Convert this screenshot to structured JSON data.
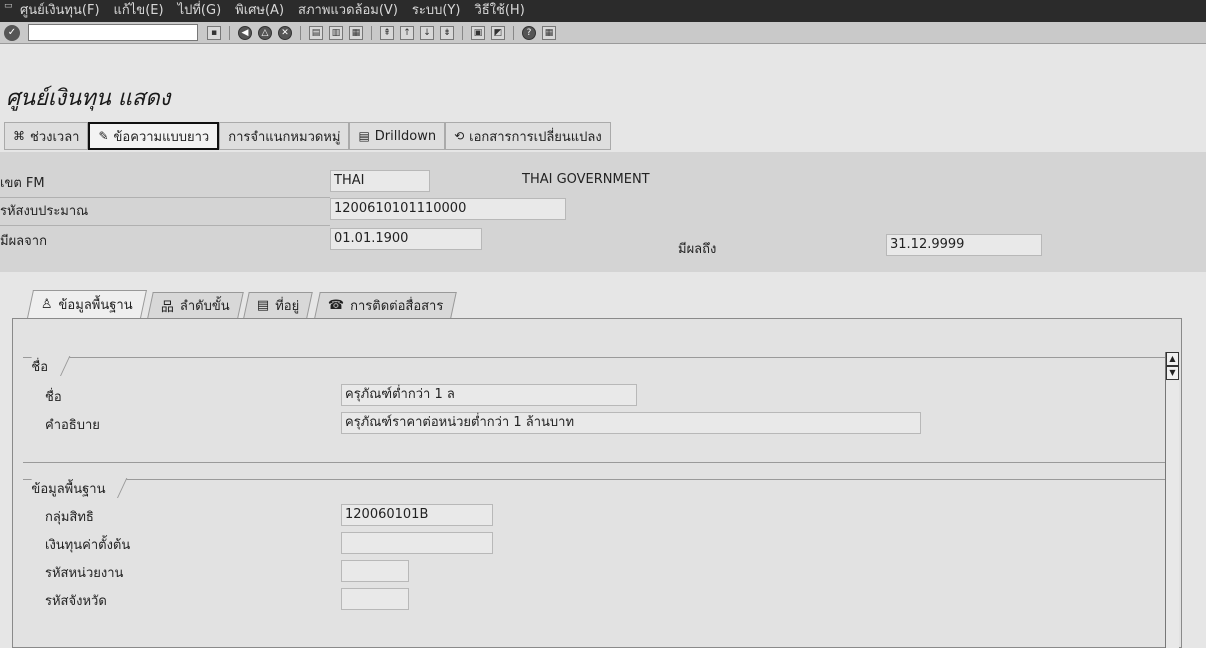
{
  "menu": {
    "items": [
      "ศูนย์เงินทุน(F)",
      "แก้ไข(E)",
      "ไปที่(G)",
      "พิเศษ(A)",
      "สภาพแวดล้อม(V)",
      "ระบบ(Y)",
      "วิธีใช้(H)"
    ]
  },
  "page": {
    "title": "ศูนย์เงินทุน แสดง"
  },
  "app_toolbar": {
    "period": "ช่วงเวลา",
    "long_text": "ข้อความแบบยาว",
    "classification": "การจำแนกหมวดหมู่",
    "drilldown": "Drilldown",
    "change_docs": "เอกสารการเปลี่ยนแปลง"
  },
  "header": {
    "fm_area_label": "เขต FM",
    "fm_area_value": "THAI",
    "fm_area_desc": "THAI GOVERNMENT",
    "budget_code_label": "รหัสงบประมาณ",
    "budget_code_value": "1200610101110000",
    "valid_from_label": "มีผลจาก",
    "valid_from_value": "01.01.1900",
    "valid_to_label": "มีผลถึง",
    "valid_to_value": "31.12.9999"
  },
  "tabs": [
    {
      "label": "ข้อมูลพื้นฐาน"
    },
    {
      "label": "ลำดับขั้น"
    },
    {
      "label": "ที่อยู่"
    },
    {
      "label": "การติดต่อสื่อสาร"
    }
  ],
  "name_group": {
    "title": "ชื่อ",
    "name_label": "ชื่อ",
    "name_value": "ครุภัณฑ์ต่ำกว่า 1 ล",
    "desc_label": "คำอธิบาย",
    "desc_value": "ครุภัณฑ์ราคาต่อหน่วยต่ำกว่า 1 ล้านบาท"
  },
  "basic_group": {
    "title": "ข้อมูลพื้นฐาน",
    "auth_group_label": "กลุ่มสิทธิ",
    "auth_group_value": "120060101B",
    "default_fund_label": "เงินทุนค่าตั้งต้น",
    "default_fund_value": "",
    "agency_code_label": "รหัสหน่วยงาน",
    "agency_code_value": "",
    "province_code_label": "รหัสจังหวัด",
    "province_code_value": ""
  }
}
